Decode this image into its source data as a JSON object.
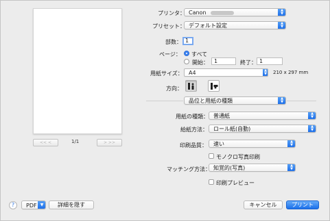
{
  "preview": {
    "page_indicator": "1/1",
    "first_btn": "<<  <",
    "last_btn": ">  >>"
  },
  "printer": {
    "label": "プリンタ：",
    "value": "Canon"
  },
  "preset": {
    "label": "プリセット：",
    "value": "デフォルト設定"
  },
  "copies": {
    "label": "部数：",
    "value": "1"
  },
  "pages": {
    "label": "ページ：",
    "all_label": "すべて",
    "from_label": "開始：",
    "from_value": "1",
    "to_label": "終了：",
    "to_value": "1"
  },
  "paper_size": {
    "label": "用紙サイズ：",
    "value": "A4",
    "dimensions": "210 x 297 mm"
  },
  "orientation": {
    "label": "方向："
  },
  "panel_menu": {
    "value": "品位と用紙の種類"
  },
  "media_type": {
    "label": "用紙の種類：",
    "value": "普通紙"
  },
  "paper_source": {
    "label": "給紙方法：",
    "value": "ロール紙(自動)"
  },
  "print_quality": {
    "label": "印刷品質：",
    "value": "速い"
  },
  "grayscale": {
    "label": "モノクロ写真印刷"
  },
  "matching": {
    "label": "マッチング方法：",
    "value": "知覚的(写真)"
  },
  "print_preview": {
    "label": "印刷プレビュー"
  },
  "footer": {
    "help": "?",
    "pdf_label": "PDF",
    "hide_details_label": "詳細を隠す",
    "cancel_label": "キャンセル",
    "print_label": "プリント"
  }
}
